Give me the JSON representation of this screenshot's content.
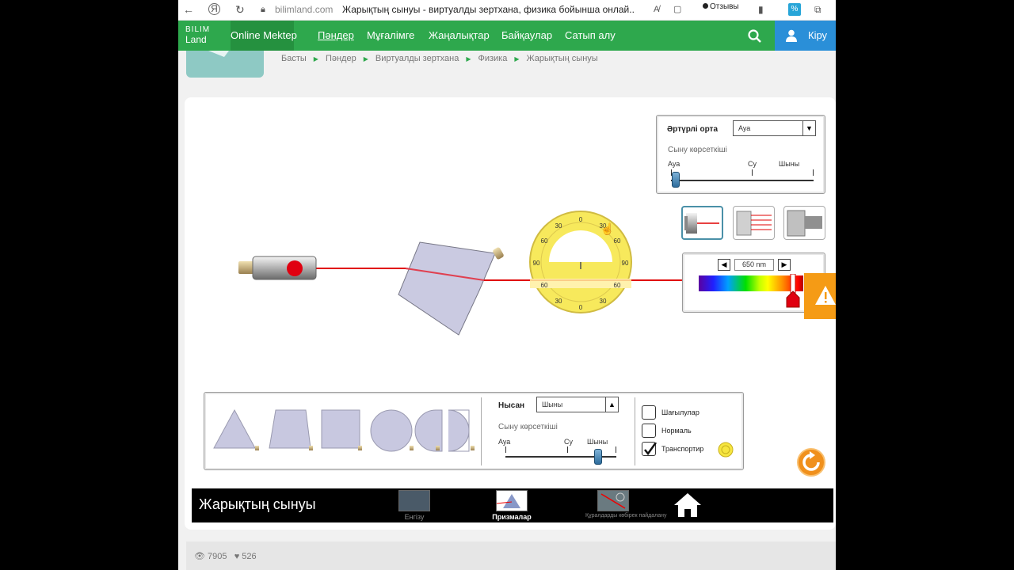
{
  "browser": {
    "domain": "bilimland.com",
    "title": "Жарықтың сынуы - виртуалды зертхана, физика бойынша онлай...",
    "feedback": "Отзывы",
    "ext_badge": "%"
  },
  "nav": {
    "logo_line1": "BILIM",
    "logo_line2": "Land",
    "items": [
      "Online Mektep",
      "Пәндер",
      "Мұғалімге",
      "Жаңалықтар",
      "Байқаулар",
      "Сатып алу"
    ],
    "login": "Кіру"
  },
  "breadcrumb": [
    "Басты",
    "Пәндер",
    "Виртуалды зертхана",
    "Физика",
    "Жарықтың сынуы"
  ],
  "medium_panel": {
    "label": "Әртүрлі орта",
    "selected": "Ауа",
    "index_label": "Сыну көрсеткіші",
    "ticks": [
      "Ауа",
      "Су",
      "Шыны"
    ]
  },
  "wavelength": {
    "value": "650 nm",
    "left_arrow": "◀",
    "right_arrow": "▶"
  },
  "object_panel": {
    "label": "Нысан",
    "selected": "Шыны",
    "index_label": "Сыну көрсеткіші",
    "ticks": [
      "Ауа",
      "Су",
      "Шыны"
    ],
    "checkboxes": [
      {
        "label": "Шағылулар",
        "checked": false
      },
      {
        "label": "Нормаль",
        "checked": false
      },
      {
        "label": "Транспортир",
        "checked": true
      }
    ]
  },
  "protractor": {
    "labels_top": [
      "0",
      "30",
      "30",
      "60",
      "60",
      "90",
      "90"
    ],
    "labels_bottom": [
      "60",
      "60",
      "30",
      "30",
      "0"
    ]
  },
  "footer": {
    "title": "Жарықтың сынуы",
    "tabs": [
      "Енгізу",
      "Призмалар",
      "Құралдарды көбірек пайдалану"
    ]
  },
  "stats": {
    "views": "7905",
    "likes": "526"
  },
  "colors": {
    "green": "#2ea84d",
    "blue": "#2a8fd8",
    "laser": "#e00000",
    "orange": "#f59b15"
  }
}
